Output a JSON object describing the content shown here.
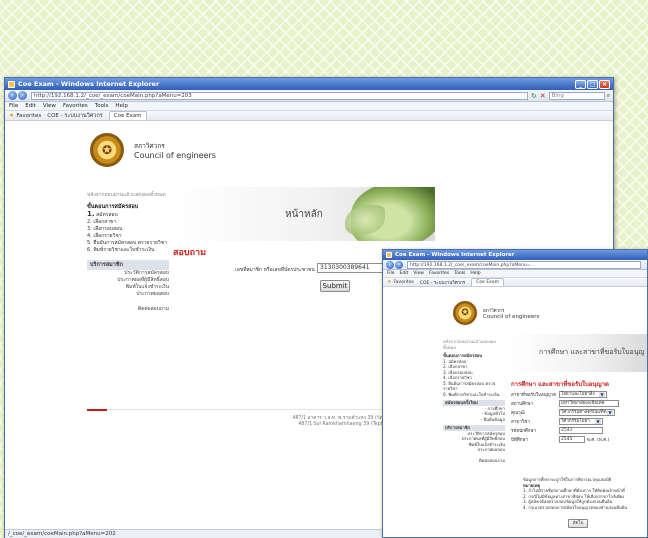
{
  "main_window": {
    "title": "Coe Exam - Windows Internet Explorer",
    "url": "http://192.168.1.2/_coe/_exam/coeMain.php?aMenu=203",
    "search_placeholder": "Bing",
    "menu": [
      "File",
      "Edit",
      "View",
      "Favorites",
      "Tools",
      "Help"
    ],
    "favorites_label": "Favorites",
    "fav_link": "COE - ระบบงานวิศวกร",
    "tab_label": "Coe Exam",
    "status_url": "/_coe/_exam/coeMain.php?aMenu=202"
  },
  "header": {
    "org_th": "สภาวิศวกร",
    "org_en": "Council of engineers"
  },
  "sidebar": {
    "note": "หลังจากสอบผ่านแล้วแสดงผลทั้งหมด",
    "process_heading": "ขั้นตอนการสมัครสอบ",
    "steps": [
      {
        "num": "1.",
        "label": "สมัครสอบ"
      },
      {
        "num": "2.",
        "label": "เลือกสาขา"
      },
      {
        "num": "3.",
        "label": "เลือกรอบสอบ"
      },
      {
        "num": "4.",
        "label": "เลือกรายวิชา"
      },
      {
        "num": "5.",
        "label": "ยืนยันการสมัครสอบ ตรวจรายวิชา"
      },
      {
        "num": "6.",
        "label": "พิมพ์รายวิชาและใบชำระเงิน"
      }
    ],
    "service_heading": "บริการสมาชิก",
    "service_items": [
      "ประวัติการสมัครสอบ",
      "ประกาศผลที่ผู้มีสิทธิ์สอบ",
      "พิมพ์ใบแจ้งชำระเงิน",
      "ประกาศผลสอบ"
    ],
    "contact": "ติดต่อสอบถาม"
  },
  "main": {
    "banner_title": "หน้าหลัก",
    "section_title": "สอบถาม",
    "id_label": "เลขที่สมาชิก หรือเลขที่บัตรประชาชน",
    "id_value": "3130300389641",
    "submit_label": "Submit",
    "footer_line1": "487/1 อาคาร ว.ส.ท. ซ.รามคำแหง 39 (วัดเทพลีลา) ถนนรามคำแหง",
    "footer_line2": "487/1 Soi Ramkhamhaeng 39 (Tepleela) Ramkhamhaeng"
  },
  "second_window": {
    "title": "Coe Exam - Windows Internet Explorer",
    "url": "http://192.168.1.2/_coe/_exam/coeMain.php?aMenu=...",
    "menu": [
      "File",
      "Edit",
      "View",
      "Favorites",
      "Tools",
      "Help"
    ],
    "favorites_label": "Favorites",
    "fav_link": "COE - ระบบงานวิศวกร",
    "tab_label": "Coe Exam",
    "org_th": "สภาวิศวกร",
    "org_en": "Council of engineers",
    "sidebar_note": "หลังจากสอบผ่านแล้วแสดงผลทั้งหมด",
    "process_heading": "ขั้นตอนการสมัครสอบ",
    "steps": [
      "1. สมัครสอบ",
      "2. เลือกสาขา",
      "3. เลือกรอบสอบ",
      "4. เลือกรายวิชา",
      "5. ยืนยันการสมัครสอบ ตรวจรายวิชา",
      "6. พิมพ์รายวิชาและใบชำระเงิน"
    ],
    "new_user_heading": "สมัครสอบครั้งใหม่",
    "new_user_items": [
      "- การศึกษา",
      "- ข้อมูลทั่วไป",
      "- ยืนยันข้อมูล"
    ],
    "service_heading": "บริการสมาชิก",
    "service_items": [
      "ประวัติการสมัครสอบ",
      "ประกาศผลที่ผู้มีสิทธิ์สอบ",
      "พิมพ์ใบแจ้งชำระเงิน",
      "ประกาศผลสอบ"
    ],
    "contact": "ติดต่อสอบถาม",
    "banner_title": "การศึกษา และสาขาที่ขอรับใบอนุญ",
    "section_title": "การศึกษา และสาขาที่ขอรับใบอนุญาต",
    "fields": [
      {
        "label": "สาขาที่ขอรับใบอนุญาต",
        "value": "โยธาและโยธาสิ่ง",
        "type": "select"
      },
      {
        "label": "สถานศึกษา",
        "value": "มหาวิทยาลัยเอเชียเทค",
        "type": "input"
      },
      {
        "label": "คุณวุฒิ",
        "value": "วิศวกรรมศาสตรบัณฑิต",
        "type": "select"
      },
      {
        "label": "สาขาวิชา",
        "value": "วิศวกรรมโยธา",
        "type": "select"
      },
      {
        "label": "รหัสนักศึกษา",
        "value": "2541",
        "type": "input"
      },
      {
        "label": "ปีที่ศึกษา",
        "value": "2545",
        "type": "input",
        "suffix": "พ.ศ. (พ.ศ.)"
      }
    ],
    "notes_heading": "หมายเหตุ",
    "notes": [
      "ข้อมูลการศึกษาจะถูกใช้ในการพิจารณาคุณสมบัติ",
      "1. ถ้าไม่มีรายชื่อสถานศึกษาที่ต้องการ ให้ติดต่อเจ้าหน้าที่",
      "2. กรณีไม่มีข้อมูลทางสาขาที่สอบ ให้เลือกสาขาใกล้เคียง",
      "3. ผู้สมัครต้องตรวจสอบข้อมูลให้ถูกต้องก่อนยืนยัน",
      "4. กรุณาตรวจสอบการสมัครใบอนุญาตของท่านก่อนยืนยัน"
    ],
    "next_label": "ถัดไป"
  },
  "colors": {
    "accent_red": "#cc2222",
    "titlebar_blue": "#2f5fb8",
    "background": "#e9f1c9"
  }
}
